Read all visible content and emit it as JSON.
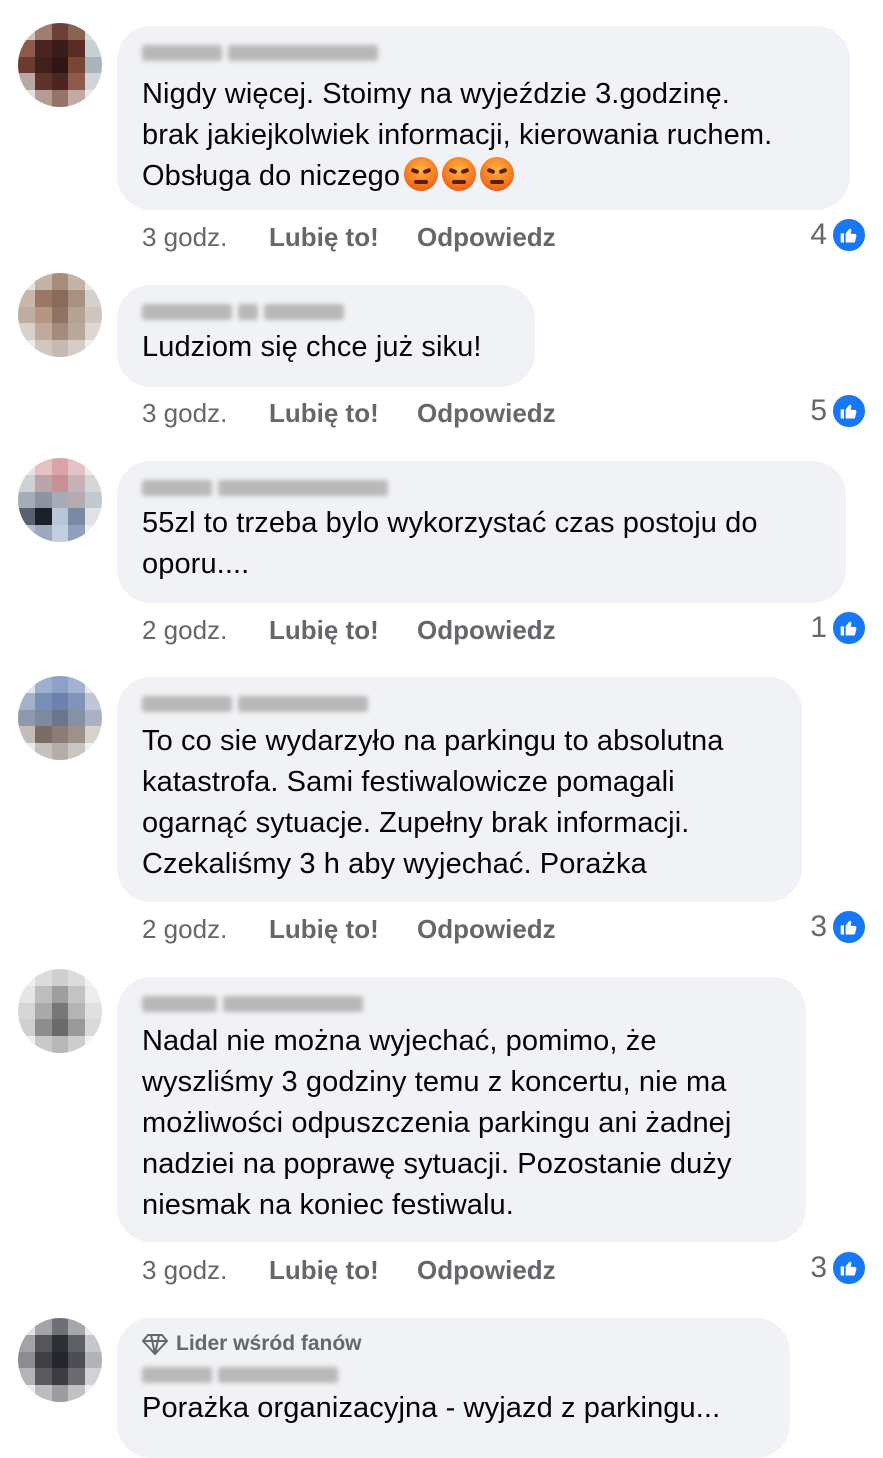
{
  "comments": [
    {
      "text_lines": [
        "Nigdy więcej.  Stoimy na wyjeździe 3.godzinę.",
        "brak jakiejkolwiek informacji, kierowania ruchem.",
        "Obsługa do niczego"
      ],
      "emoji_count": 3,
      "emoji_name": "angry-face-emoji",
      "time": "3 godz.",
      "like_label": "Lubię to!",
      "reply_label": "Odpowiedz",
      "reactions": "4"
    },
    {
      "text_lines": [
        "Ludziom się chce już siku!"
      ],
      "time": "3 godz.",
      "like_label": "Lubię to!",
      "reply_label": "Odpowiedz",
      "reactions": "5"
    },
    {
      "text_lines": [
        "55zl to trzeba bylo wykorzystać czas postoju do",
        "oporu...."
      ],
      "time": "2 godz.",
      "like_label": "Lubię to!",
      "reply_label": "Odpowiedz",
      "reactions": "1"
    },
    {
      "text_lines": [
        "To co sie wydarzyło na parkingu to absolutna",
        "katastrofa. Sami festiwalowicze pomagali",
        "ogarnąć sytuacje. Zupełny brak informacji.",
        "Czekaliśmy 3 h aby wyjechać. Porażka"
      ],
      "time": "2 godz.",
      "like_label": "Lubię to!",
      "reply_label": "Odpowiedz",
      "reactions": "3"
    },
    {
      "text_lines": [
        "Nadal nie można wyjechać, pomimo, że",
        "wyszliśmy 3 godziny temu z koncertu, nie ma",
        "możliwości odpuszczenia parkingu ani żadnej",
        "nadziei na poprawę sytuacji. Pozostanie duży",
        "niesmak na koniec festiwalu."
      ],
      "time": "3 godz.",
      "like_label": "Lubię to!",
      "reply_label": "Odpowiedz",
      "reactions": "3"
    },
    {
      "badge": "Lider wśród fanów",
      "text_lines": [
        "Porażka organizacyjna - wyjazd z parkingu..."
      ]
    }
  ],
  "colors": {
    "bubble": "#f0f2f5",
    "meta_text": "#65676b",
    "like_blue": "#1877f2"
  },
  "icons": {
    "like": "thumbs-up-icon",
    "fan_badge": "diamond-icon"
  }
}
